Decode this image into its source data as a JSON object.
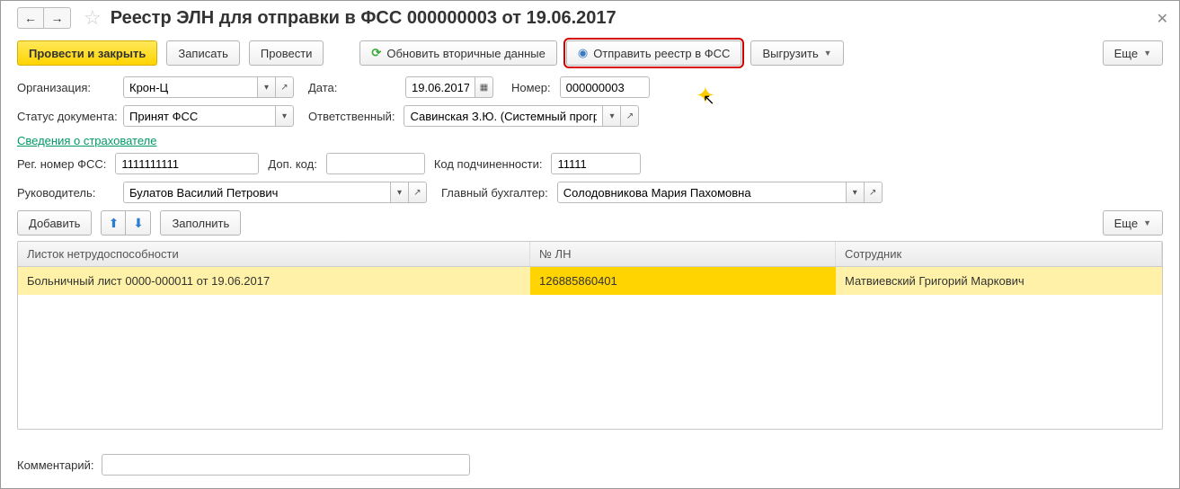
{
  "header": {
    "title": "Реестр ЭЛН для отправки в ФСС 000000003 от 19.06.2017"
  },
  "toolbar": {
    "post_close": "Провести и закрыть",
    "save": "Записать",
    "post": "Провести",
    "refresh": "Обновить вторичные данные",
    "send": "Отправить реестр в ФСС",
    "export": "Выгрузить",
    "more": "Еще"
  },
  "labels": {
    "org": "Организация:",
    "date": "Дата:",
    "number": "Номер:",
    "doc_status": "Статус документа:",
    "responsible": "Ответственный:",
    "section_insurer": "Сведения о страхователе",
    "reg_fss": "Рег. номер ФСС:",
    "add_code": "Доп. код:",
    "sub_code": "Код подчиненности:",
    "head": "Руководитель:",
    "chief_acc": "Главный бухгалтер:",
    "comment": "Комментарий:"
  },
  "fields": {
    "org": "Крон-Ц",
    "date": "19.06.2017",
    "number": "000000003",
    "doc_status": "Принят ФСС",
    "responsible": "Савинская З.Ю. (Системный програм",
    "reg_fss": "1111111111",
    "add_code": "",
    "sub_code": "11111",
    "head": "Булатов Василий Петрович",
    "chief_acc": "Солодовникова Мария Пахомовна",
    "comment": ""
  },
  "tbl_toolbar": {
    "add": "Добавить",
    "fill": "Заполнить",
    "more": "Еще"
  },
  "table": {
    "cols": {
      "c1": "Листок нетрудоспособности",
      "c2": "№ ЛН",
      "c3": "Сотрудник"
    },
    "rows": [
      {
        "c1": "Больничный лист 0000-000011 от 19.06.2017",
        "c2": "126885860401",
        "c3": "Матвиевский Григорий Маркович"
      }
    ]
  }
}
